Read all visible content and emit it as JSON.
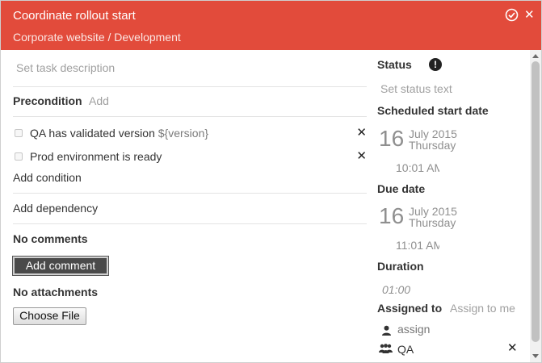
{
  "header": {
    "title": "Coordinate rollout start",
    "breadcrumb": "Corporate website / Development",
    "check_icon": "check-circle-icon",
    "close_icon": "close-icon",
    "close_glyph": "✕"
  },
  "task": {
    "description_placeholder": "Set task description"
  },
  "precondition": {
    "label": "Precondition",
    "add_label": "Add",
    "conditions": [
      {
        "text": "QA has validated version",
        "variable": "${version}",
        "remove": "✕"
      },
      {
        "text": "Prod environment is ready",
        "variable": "",
        "remove": "✕"
      }
    ],
    "add_condition": "Add condition"
  },
  "dependency": {
    "add_label": "Add dependency"
  },
  "comments": {
    "empty_label": "No comments",
    "add_button": "Add comment"
  },
  "attachments": {
    "empty_label": "No attachments",
    "choose_button": "Choose File"
  },
  "status": {
    "label": "Status",
    "icon_glyph": "!",
    "placeholder": "Set status text"
  },
  "scheduled_start": {
    "label": "Scheduled start date",
    "day": "16",
    "month_year": "July 2015",
    "weekday": "Thursday",
    "time": "10:01 AM"
  },
  "due": {
    "label": "Due date",
    "day": "16",
    "month_year": "July 2015",
    "weekday": "Thursday",
    "time": "11:01 AM"
  },
  "duration": {
    "label": "Duration",
    "value": "01:00"
  },
  "assigned": {
    "label": "Assigned to",
    "assign_me": "Assign to me",
    "user_placeholder": "assign",
    "team": "QA",
    "remove": "✕"
  },
  "colors": {
    "header_bg": "#e24b3b",
    "button_dark": "#4a4a4a"
  }
}
